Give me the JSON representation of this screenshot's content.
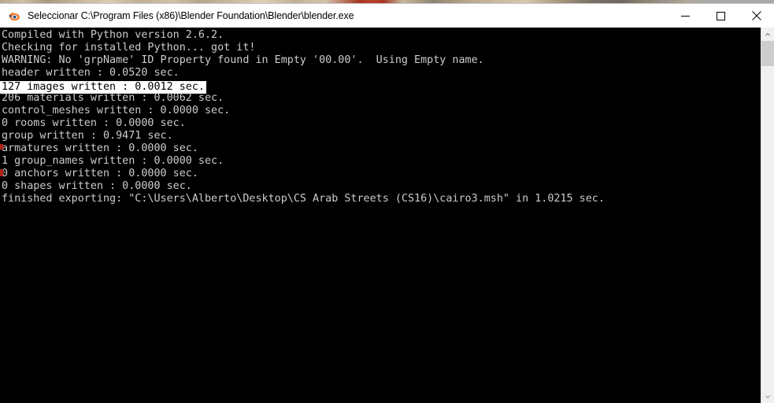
{
  "window": {
    "title": "Seleccionar C:\\Program Files (x86)\\Blender Foundation\\Blender\\blender.exe",
    "app_icon": "blender-icon",
    "controls": {
      "minimize": "minimize-icon",
      "maximize": "maximize-icon",
      "close": "close-icon"
    }
  },
  "console": {
    "background_color": "#000000",
    "text_color": "#cccccc",
    "highlight_background": "#ffffff",
    "highlight_text": "#000000",
    "lines": [
      {
        "text": "Compiled with Python version 2.6.2.",
        "highlighted": false
      },
      {
        "text": "Checking for installed Python... got it!",
        "highlighted": false
      },
      {
        "text": "WARNING: No 'grpName' ID Property found in Empty '00.00'.  Using Empty name.",
        "highlighted": false
      },
      {
        "text": "header written : 0.0520 sec.",
        "highlighted": false
      },
      {
        "text": "127 images written : 0.0012 sec.",
        "highlighted": true
      },
      {
        "text": "206 materials written : 0.0062 sec.",
        "highlighted": false
      },
      {
        "text": "control_meshes written : 0.0000 sec.",
        "highlighted": false
      },
      {
        "text": "0 rooms written : 0.0000 sec.",
        "highlighted": false
      },
      {
        "text": "group written : 0.9471 sec.",
        "highlighted": false
      },
      {
        "text": "armatures written : 0.0000 sec.",
        "highlighted": false
      },
      {
        "text": "1 group_names written : 0.0000 sec.",
        "highlighted": false
      },
      {
        "text": "0 anchors written : 0.0000 sec.",
        "highlighted": false
      },
      {
        "text": "0 shapes written : 0.0000 sec.",
        "highlighted": false
      },
      {
        "text": "finished exporting: \"C:\\Users\\Alberto\\Desktop\\CS Arab Streets (CS16)\\cairo3.msh\" in 1.0215 sec.",
        "highlighted": false
      }
    ]
  },
  "scrollbar": {
    "up_arrow": "chevron-up-icon",
    "down_arrow": "chevron-down-icon",
    "thumb": "scrollbar-thumb"
  }
}
